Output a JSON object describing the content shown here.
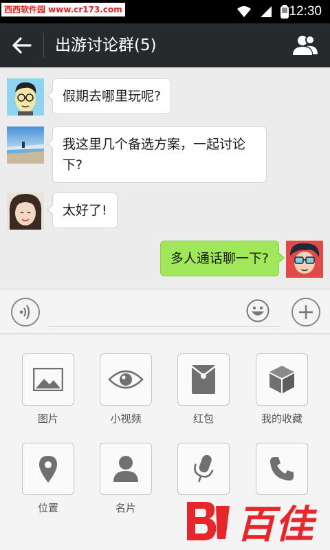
{
  "status_bar": {
    "watermark": "西西软件园 www.cr173.com",
    "time": "12:30"
  },
  "header": {
    "title": "出游讨论群(5)"
  },
  "messages": [
    {
      "side": "left",
      "text": "假期去哪里玩呢?"
    },
    {
      "side": "left",
      "text": "我这里几个备选方案，一起讨论下?"
    },
    {
      "side": "left",
      "text": "太好了!"
    },
    {
      "side": "right",
      "text": "多人通话聊一下?"
    }
  ],
  "input": {
    "value": "",
    "placeholder": ""
  },
  "tools": [
    {
      "label": "图片",
      "icon": "image-icon"
    },
    {
      "label": "小视频",
      "icon": "eye-icon"
    },
    {
      "label": "红包",
      "icon": "red-packet-icon"
    },
    {
      "label": "我的收藏",
      "icon": "cube-icon"
    },
    {
      "label": "位置",
      "icon": "location-pin-icon"
    },
    {
      "label": "名片",
      "icon": "person-icon"
    },
    {
      "label": "",
      "icon": "microphone-icon"
    },
    {
      "label": "",
      "icon": "phone-icon"
    }
  ],
  "brand": {
    "logo_text": "百佳",
    "logo_mark": "B"
  },
  "colors": {
    "header_bg": "#262a2d",
    "bubble_right": "#a0e75a",
    "brand_red": "#e8252a"
  }
}
